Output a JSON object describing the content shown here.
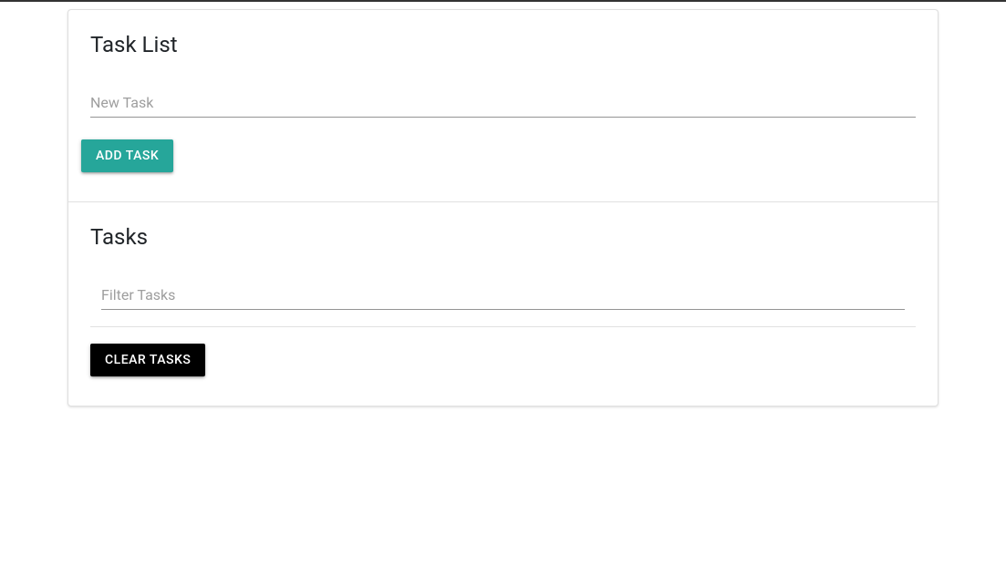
{
  "addSection": {
    "heading": "Task List",
    "inputPlaceholder": "New Task",
    "inputValue": "",
    "addButtonLabel": "Add Task"
  },
  "listSection": {
    "heading": "Tasks",
    "filterPlaceholder": "Filter Tasks",
    "filterValue": "",
    "clearButtonLabel": "Clear Tasks"
  }
}
